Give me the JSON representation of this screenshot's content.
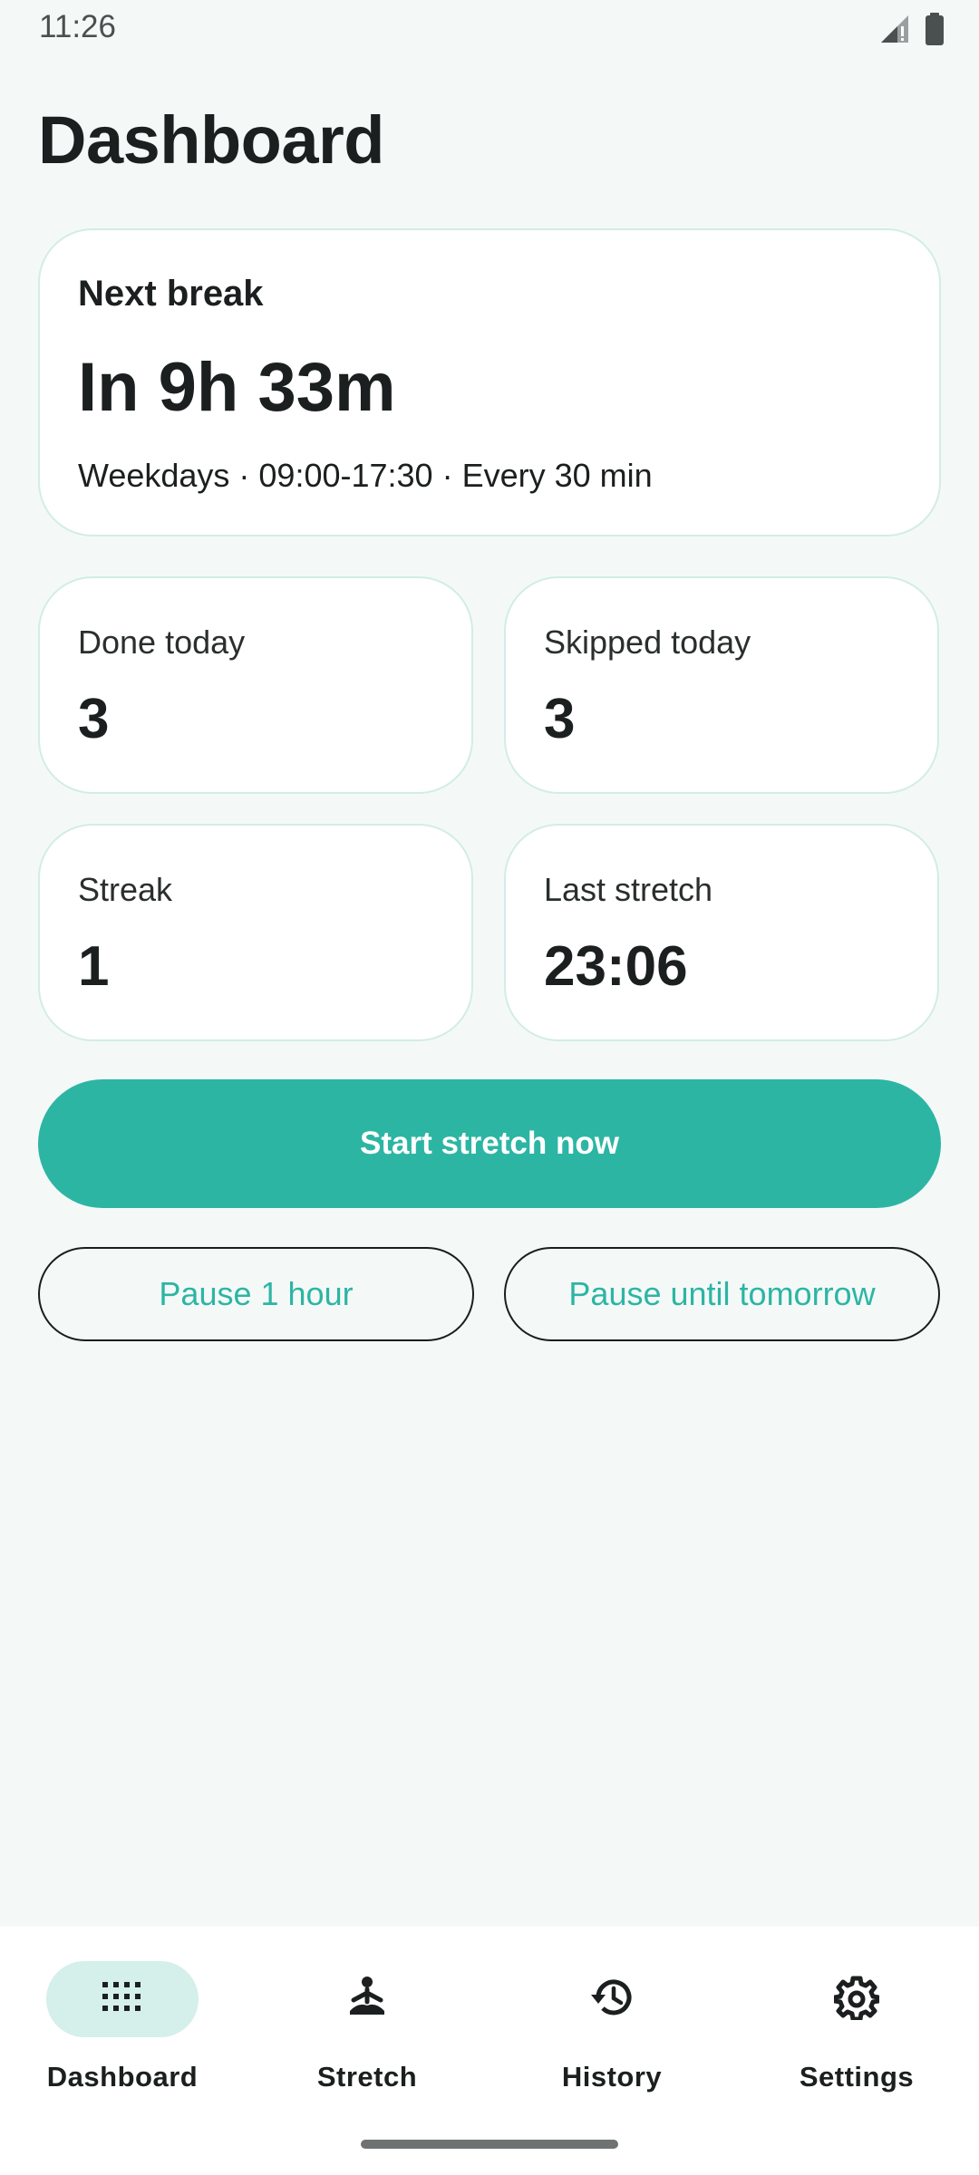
{
  "status_bar": {
    "time": "11:26",
    "icons": [
      "signal-icon",
      "battery-icon"
    ]
  },
  "page": {
    "title": "Dashboard"
  },
  "next_break": {
    "label": "Next break",
    "countdown": "In 9h 33m",
    "schedule": "Weekdays · 09:00-17:30 · Every 30 min"
  },
  "stats": {
    "done_today": {
      "label": "Done today",
      "value": "3"
    },
    "skipped_today": {
      "label": "Skipped today",
      "value": "3"
    },
    "streak": {
      "label": "Streak",
      "value": "1"
    },
    "last_stretch": {
      "label": "Last stretch",
      "value": "23:06"
    }
  },
  "actions": {
    "start_label": "Start stretch now",
    "pause_hour_label": "Pause 1 hour",
    "pause_tomorrow_label": "Pause until tomorrow"
  },
  "nav": {
    "items": [
      {
        "label": "Dashboard",
        "icon": "grid-icon",
        "active": true
      },
      {
        "label": "Stretch",
        "icon": "stretch-icon",
        "active": false
      },
      {
        "label": "History",
        "icon": "history-icon",
        "active": false
      },
      {
        "label": "Settings",
        "icon": "gear-icon",
        "active": false
      }
    ]
  },
  "colors": {
    "accent": "#2db5a4",
    "background": "#f4f9f8",
    "card_border": "#d3ece7",
    "nav_indicator": "#d5efeb"
  }
}
